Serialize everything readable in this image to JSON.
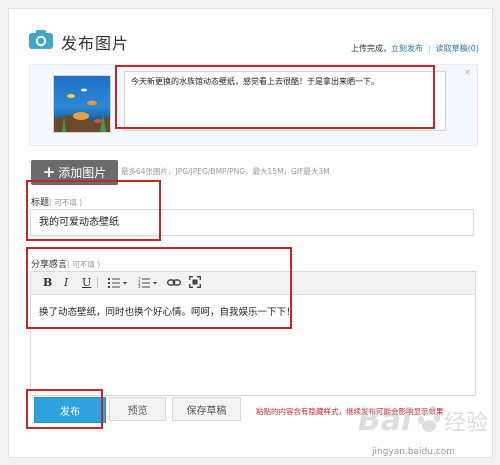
{
  "header": {
    "title": "发布图片",
    "status": "上传完成，",
    "publish_now_link": "立刻发布",
    "read_drafts_link": "读取草稿(0)",
    "camera_icon": "camera-icon"
  },
  "upload": {
    "caption": "今天新更换的水族馆动态壁纸，感觉看上去很酷！于是拿出来晒一下。",
    "close_icon": "×",
    "add_button_label": "添加图片",
    "file_hint": "最多64张图片，JPG/JPEG/BMP/PNG，最大15M，GIF最大3M"
  },
  "title_field": {
    "label": "标题",
    "optional": "( 可不填 )",
    "value": "我的可爱动态壁纸"
  },
  "feelings_field": {
    "label": "分享感言",
    "optional": "( 可不填 )",
    "toolbar": {
      "bold": "B",
      "italic": "I",
      "underline": "U",
      "icons": [
        "bullet-list-icon",
        "numbered-list-icon",
        "link-icon",
        "fullscreen-icon"
      ]
    },
    "body": "换了动态壁纸，同时也换个好心情。呵呵，自我娱乐一下下！"
  },
  "actions": {
    "publish_label": "发布",
    "preview_label": "预览",
    "save_draft_label": "保存草稿",
    "warning": "粘贴的内容含有隐藏样式，继续发布可能会影响显示效果"
  },
  "watermark": {
    "brand": "Bai",
    "brand_suffix": "经验",
    "url": "jingyan.baidu.com"
  },
  "colors": {
    "accent_blue": "#2fa2df",
    "link_blue": "#2e73b8",
    "annotation_red": "#c0282b",
    "warning_red": "#c62828"
  }
}
